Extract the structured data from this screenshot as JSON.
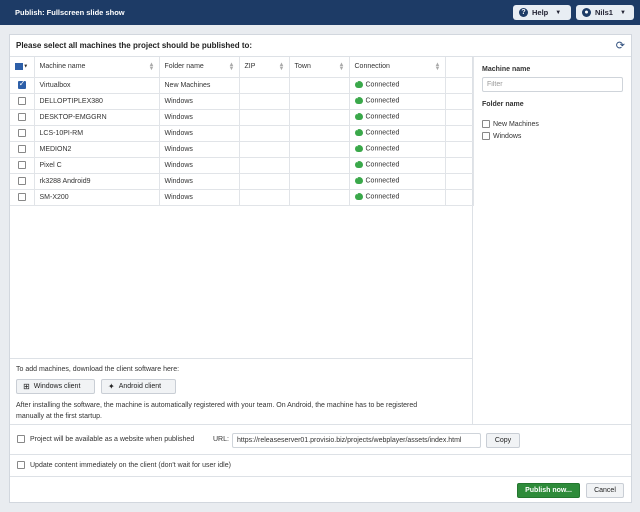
{
  "window": {
    "title": "Publish: Fullscreen slide show",
    "help_label": "Help",
    "user_label": "Nils1"
  },
  "dialog": {
    "heading": "Please select all machines the project should be published to:"
  },
  "table": {
    "columns": [
      "Machine name",
      "Folder name",
      "ZIP",
      "Town",
      "Connection"
    ],
    "rows": [
      {
        "checked": true,
        "machine": "Virtualbox",
        "folder": "New Machines",
        "zip": "",
        "town": "",
        "connection": "Connected"
      },
      {
        "checked": false,
        "machine": "DELLOPTIPLEX380",
        "folder": "Windows",
        "zip": "",
        "town": "",
        "connection": "Connected"
      },
      {
        "checked": false,
        "machine": "DESKTOP-EMGGRN",
        "folder": "Windows",
        "zip": "",
        "town": "",
        "connection": "Connected"
      },
      {
        "checked": false,
        "machine": "LCS-10PI-RM",
        "folder": "Windows",
        "zip": "",
        "town": "",
        "connection": "Connected"
      },
      {
        "checked": false,
        "machine": "MEDION2",
        "folder": "Windows",
        "zip": "",
        "town": "",
        "connection": "Connected"
      },
      {
        "checked": false,
        "machine": "Pixel C",
        "folder": "Windows",
        "zip": "",
        "town": "",
        "connection": "Connected"
      },
      {
        "checked": false,
        "machine": "rk3288 Android9",
        "folder": "Windows",
        "zip": "",
        "town": "",
        "connection": "Connected"
      },
      {
        "checked": false,
        "machine": "SM-X200",
        "folder": "Windows",
        "zip": "",
        "town": "",
        "connection": "Connected"
      }
    ]
  },
  "download": {
    "intro": "To add machines, download the client software here:",
    "windows_client": "Windows client",
    "android_client": "Android client",
    "note": "After installing the software, the machine is automatically registered with your team. On Android, the machine has to be registered manually at the first startup."
  },
  "filters": {
    "machine_name_label": "Machine name",
    "machine_name_placeholder": "Filter",
    "folder_name_label": "Folder name",
    "folders": [
      "New Machines",
      "Windows"
    ]
  },
  "options": {
    "website_label": "Project will be available as a website when published",
    "url_label": "URL:",
    "url_value": "https://releaseserver01.provisio.biz/projects/webplayer/assets/index.html",
    "copy_label": "Copy",
    "update_label": "Update content immediately on the client (don't wait for user idle)"
  },
  "footer": {
    "publish_label": "Publish now...",
    "cancel_label": "Cancel"
  },
  "colors": {
    "titlebar": "#1d3b66",
    "primary": "#2e8b3a",
    "connected": "#3aa84a"
  }
}
